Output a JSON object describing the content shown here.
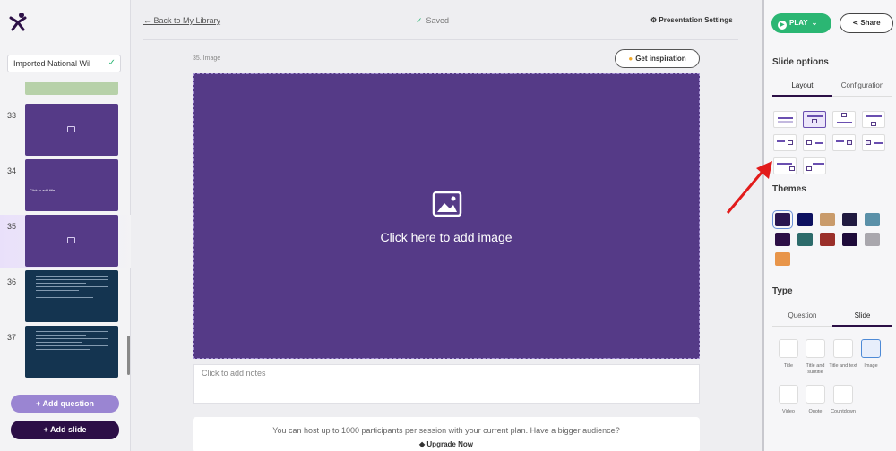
{
  "app": {
    "presentation_name": "Imported National Wil",
    "logo": "mentimeter-person-icon"
  },
  "sidebar": {
    "slides": [
      {
        "number": "",
        "style": "green"
      },
      {
        "number": "33",
        "style": "image"
      },
      {
        "number": "34",
        "style": "text",
        "text": "Click to add title.."
      },
      {
        "number": "35",
        "style": "image",
        "active": true
      },
      {
        "number": "36",
        "style": "navy"
      },
      {
        "number": "37",
        "style": "navy"
      }
    ],
    "add_question_label": "Add question",
    "add_slide_label": "Add slide"
  },
  "toolbar": {
    "back_label": "Back to My Library",
    "saved_label": "Saved",
    "settings_label": "Presentation Settings"
  },
  "editor": {
    "slide_label": "35. Image",
    "inspiration_label": "Get inspiration",
    "canvas_cta": "Click here to add image",
    "notes_placeholder": "Click to add notes",
    "banner_text": "You can host up to 1000 participants per session with your current plan. Have a bigger audience?",
    "banner_link": "Upgrade Now"
  },
  "right_panel": {
    "play_label": "PLAY",
    "share_label": "Share",
    "slide_options_title": "Slide options",
    "options_tabs": [
      "Layout",
      "Configuration"
    ],
    "themes_title": "Themes",
    "themes": [
      {
        "color": "#2a1650",
        "selected": true
      },
      {
        "color": "#0d1160"
      },
      {
        "color": "#c99b6b"
      },
      {
        "color": "#201a40"
      },
      {
        "color": "#5a90a8"
      },
      {
        "color": "#2c0f46"
      },
      {
        "color": "#2d6b6b"
      },
      {
        "color": "#9a2f2a"
      },
      {
        "color": "#1e0b3a"
      },
      {
        "color": "#a9a7ad"
      },
      {
        "color": "#e8954a"
      }
    ],
    "type_title": "Type",
    "type_tabs": [
      "Question",
      "Slide"
    ],
    "slide_types": [
      {
        "label": "Title"
      },
      {
        "label": "Title and subtitle"
      },
      {
        "label": "Title and text"
      },
      {
        "label": "Image",
        "selected": true
      },
      {
        "label": "Video"
      },
      {
        "label": "Quote"
      },
      {
        "label": "Countdown"
      }
    ]
  },
  "colors": {
    "brand_purple": "#553a87",
    "dark_purple": "#2c0f46",
    "play_green": "#2bb673",
    "annotation_arrow": "#e21b1b"
  }
}
